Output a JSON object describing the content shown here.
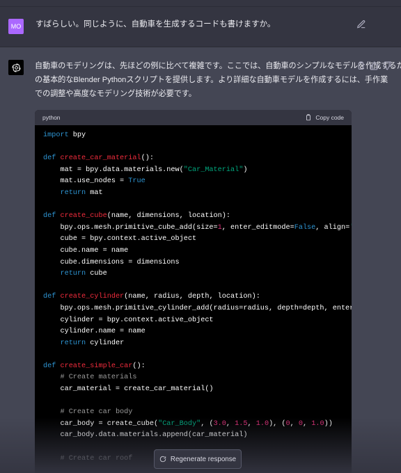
{
  "user_message": {
    "avatar_initials": "MO",
    "text": "すばらしい。同じように、自動車を生成するコードも書けますか。"
  },
  "assistant": {
    "paragraph_lines": [
      "自動車のモデリングは、先ほどの例に比べて複雑です。ここでは、自動車のシンプルなモデルを作成するため",
      "の基本的なBlender Pythonスクリプトを提供します。より詳細な自動車モデルを作成するには、手作業",
      "での調整や高度なモデリング技術が必要です。"
    ],
    "code_language": "python",
    "copy_label": "Copy code"
  },
  "code_lines": [
    [
      [
        "import",
        "kw"
      ],
      [
        " bpy",
        ""
      ]
    ],
    [],
    [
      [
        "def",
        "kw"
      ],
      [
        " ",
        ""
      ],
      [
        "create_car_material",
        "fn"
      ],
      [
        "():",
        ""
      ]
    ],
    [
      [
        "    mat = bpy.data.materials.new(",
        ""
      ],
      [
        "\"Car_Material\"",
        "st"
      ],
      [
        ")",
        ""
      ]
    ],
    [
      [
        "    mat.use_nodes = ",
        ""
      ],
      [
        "True",
        "kw"
      ]
    ],
    [
      [
        "    ",
        ""
      ],
      [
        "return",
        "kw"
      ],
      [
        " mat",
        ""
      ]
    ],
    [],
    [
      [
        "def",
        "kw"
      ],
      [
        " ",
        ""
      ],
      [
        "create_cube",
        "fn"
      ],
      [
        "(name, dimensions, location):",
        ""
      ]
    ],
    [
      [
        "    bpy.ops.mesh.primitive_cube_add(size=",
        ""
      ],
      [
        "1",
        "nm"
      ],
      [
        ", enter_editmode=",
        ""
      ],
      [
        "False",
        "kw"
      ],
      [
        ", align=",
        ""
      ],
      [
        "'WOR",
        "st"
      ]
    ],
    [
      [
        "    cube = bpy.context.active_object",
        ""
      ]
    ],
    [
      [
        "    cube.name = name",
        ""
      ]
    ],
    [
      [
        "    cube.dimensions = dimensions",
        ""
      ]
    ],
    [
      [
        "    ",
        ""
      ],
      [
        "return",
        "kw"
      ],
      [
        " cube",
        ""
      ]
    ],
    [],
    [
      [
        "def",
        "kw"
      ],
      [
        " ",
        ""
      ],
      [
        "create_cylinder",
        "fn"
      ],
      [
        "(name, radius, depth, location):",
        ""
      ]
    ],
    [
      [
        "    bpy.ops.mesh.primitive_cylinder_add(radius=radius, depth=depth, enter_ed",
        ""
      ]
    ],
    [
      [
        "    cylinder = bpy.context.active_object",
        ""
      ]
    ],
    [
      [
        "    cylinder.name = name",
        ""
      ]
    ],
    [
      [
        "    ",
        ""
      ],
      [
        "return",
        "kw"
      ],
      [
        " cylinder",
        ""
      ]
    ],
    [],
    [
      [
        "def",
        "kw"
      ],
      [
        " ",
        ""
      ],
      [
        "create_simple_car",
        "fn"
      ],
      [
        "():",
        ""
      ]
    ],
    [
      [
        "    ",
        ""
      ],
      [
        "# Create materials",
        "cm"
      ]
    ],
    [
      [
        "    car_material = create_car_material()",
        ""
      ]
    ],
    [],
    [
      [
        "    ",
        ""
      ],
      [
        "# Create car body",
        "cm"
      ]
    ],
    [
      [
        "    car_body = create_cube(",
        ""
      ],
      [
        "\"Car_Body\"",
        "st"
      ],
      [
        ", (",
        ""
      ],
      [
        "3.0",
        "nm"
      ],
      [
        ", ",
        ""
      ],
      [
        "1.5",
        "nm"
      ],
      [
        ", ",
        ""
      ],
      [
        "1.0",
        "nm"
      ],
      [
        "), (",
        ""
      ],
      [
        "0",
        "nm"
      ],
      [
        ", ",
        ""
      ],
      [
        "0",
        "nm"
      ],
      [
        ", ",
        ""
      ],
      [
        "1.0",
        "nm"
      ],
      [
        "))",
        ""
      ]
    ],
    [
      [
        "    car_body.data.materials.append(car_material)",
        ""
      ]
    ],
    [],
    [
      [
        "    ",
        ""
      ],
      [
        "# Create car roof",
        "cm"
      ]
    ]
  ],
  "regenerate_label": "Regenerate response",
  "colors": {
    "background": "#343541",
    "assistant_background": "#444654",
    "user_avatar": "#ab68ff",
    "keyword": "#2e95d3",
    "function": "#f22c3d",
    "string": "#00a67d",
    "number": "#df3079"
  }
}
